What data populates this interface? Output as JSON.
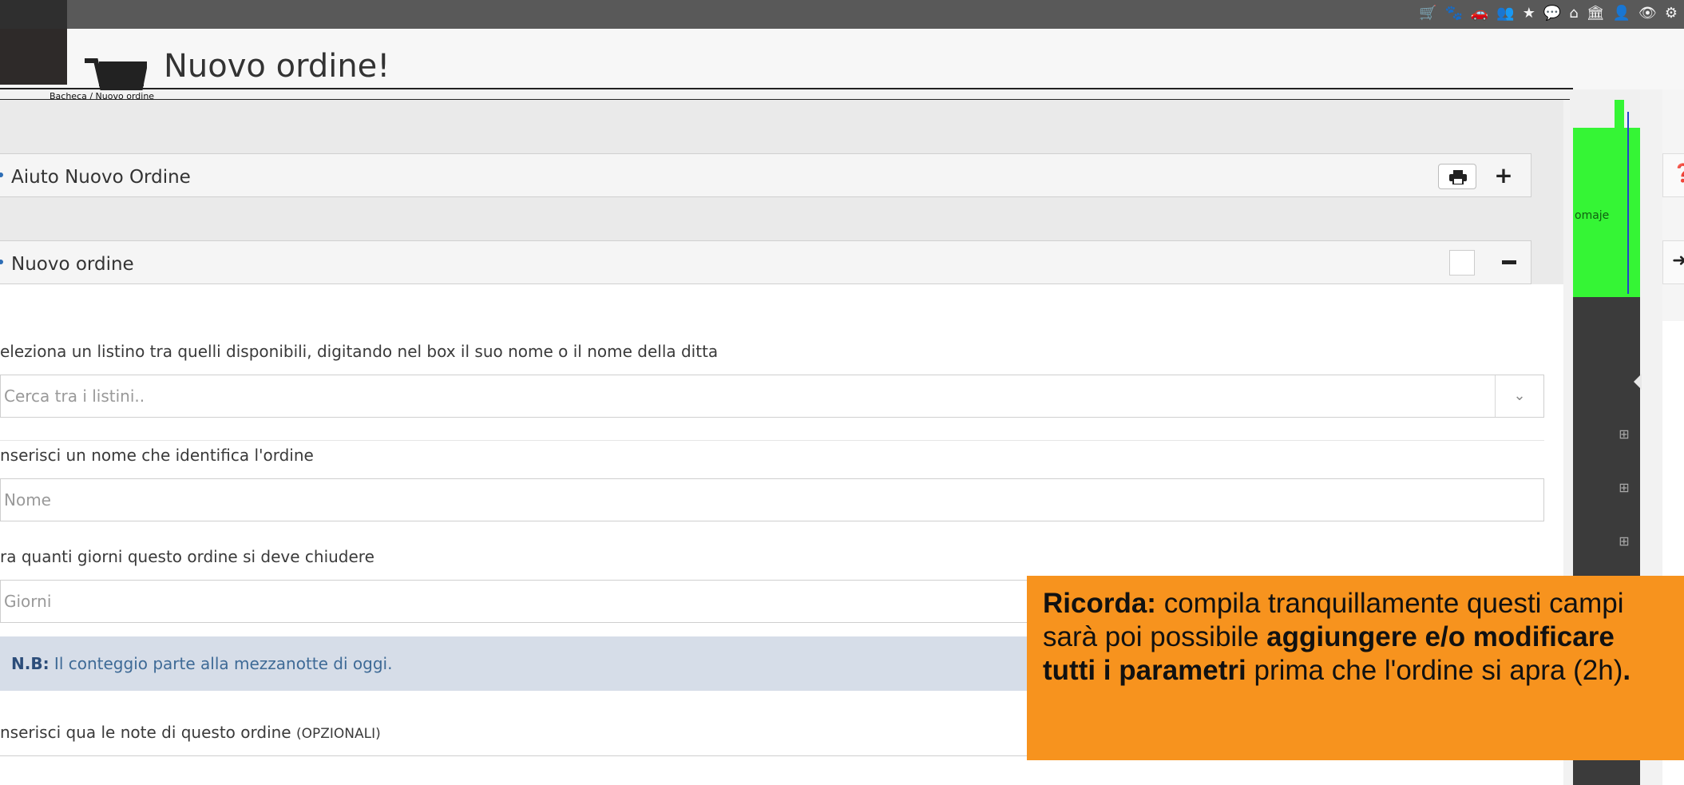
{
  "header": {
    "title": "Nuovo ordine!",
    "breadcrumb": "Bacheca / Nuovo ordine"
  },
  "help_panel": {
    "title": "Aiuto Nuovo Ordine"
  },
  "form_panel": {
    "title": "Nuovo ordine",
    "listino_label": "eleziona un listino tra quelli disponibili, digitando nel box il suo nome o il nome della ditta",
    "listino_placeholder": "Cerca tra i listini..",
    "nome_label": "nserisci un nome che identifica l'ordine",
    "nome_placeholder": "Nome",
    "giorni_label": "ra quanti giorni questo ordine si deve chiudere",
    "giorni_placeholder": "Giorni",
    "note_prefix": "N.B:",
    "note_text": " Il conteggio parte alla mezzanotte di oggi.",
    "notes_label": "nserisci qua le note di questo ordine",
    "notes_optional": "(OPZIONALI)"
  },
  "side": {
    "green_label": "omaje"
  },
  "tooltip": {
    "part1_bold": "Ricorda:",
    "part2": " compila tranquillamente questi campi sarà poi possibile ",
    "part3_bold": "aggiungere e/o modificare tutti i parametri",
    "part4": " prima che l'ordine si apra (2h)",
    "part5_bold": "."
  },
  "icons": {
    "topbar": [
      "cart-icon",
      "paw-icon",
      "car-icon",
      "group-icon",
      "star-icon",
      "comment-icon",
      "home-icon",
      "bank-icon",
      "user-icon",
      "eye-icon",
      "settings-icon"
    ]
  }
}
